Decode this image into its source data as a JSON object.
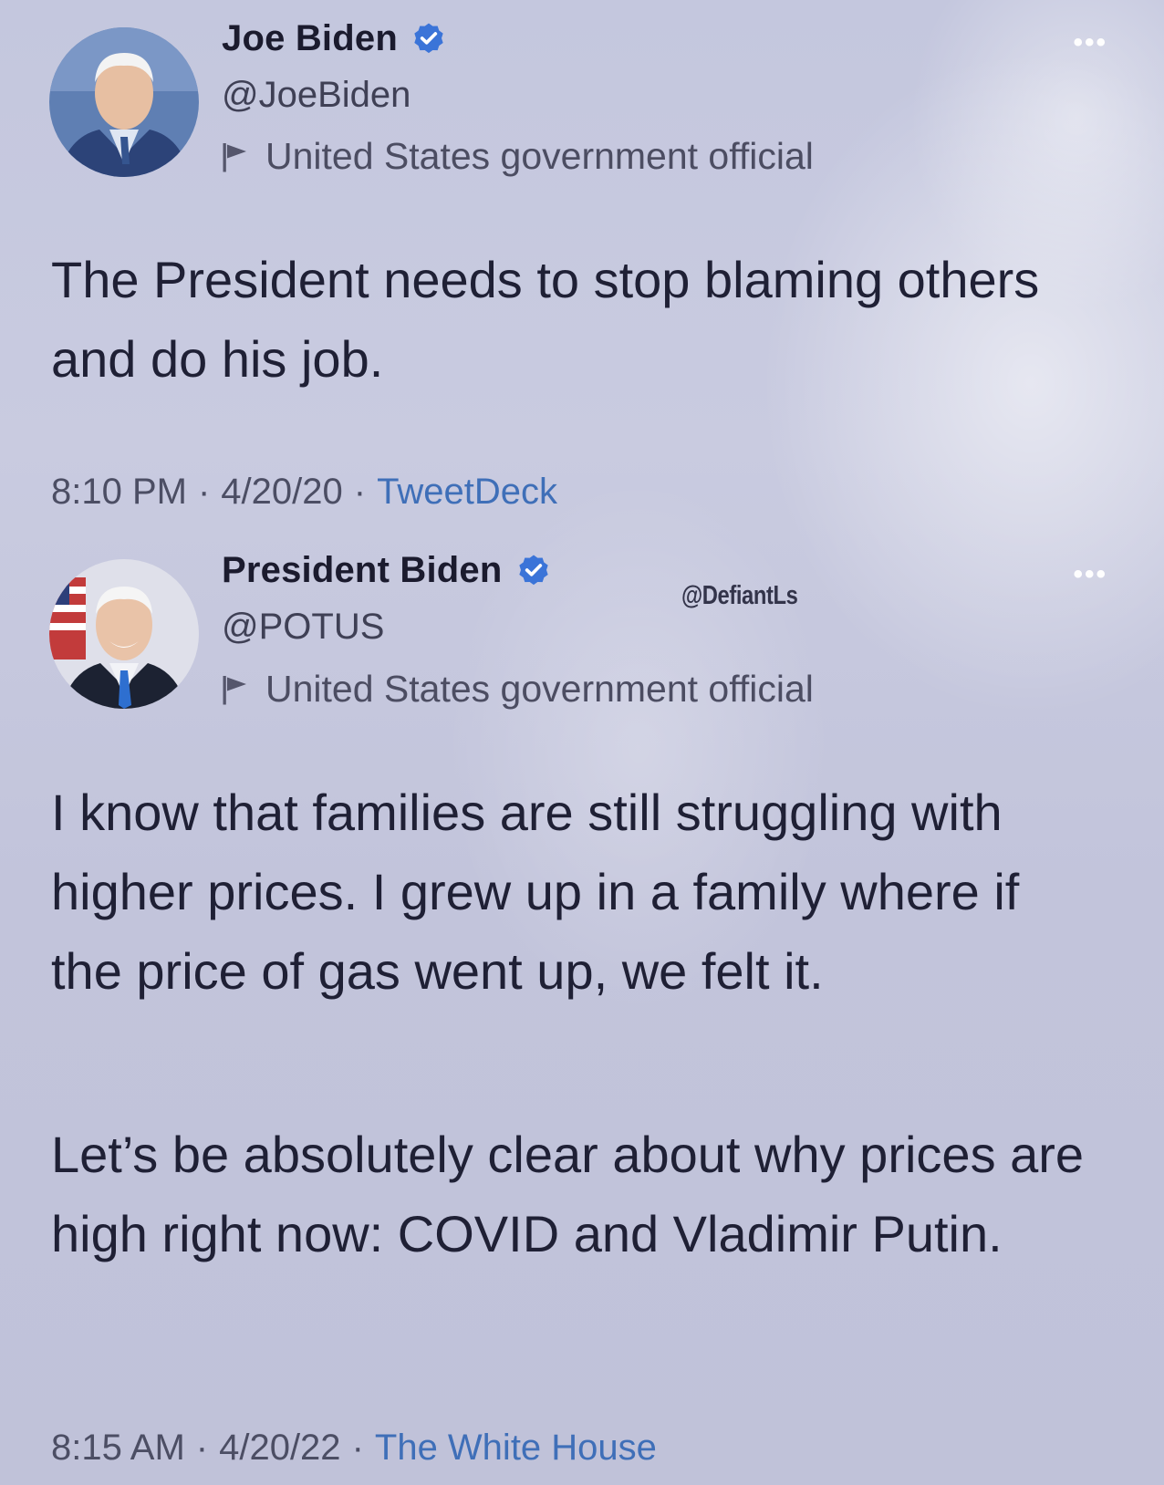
{
  "tweets": [
    {
      "name": "Joe Biden",
      "handle": "@JoeBiden",
      "label": "United States government official",
      "text": "The President needs to stop blaming others and do his job.",
      "time": "8:10 PM",
      "date": "4/20/20",
      "source": "TweetDeck",
      "more_icon": "more-horizontal-icon"
    },
    {
      "name": "President Biden",
      "handle": "@POTUS",
      "label": "United States government official",
      "paragraphs": [
        "I know that families are still struggling with higher prices. I grew up in a family where if the price of gas went up, we felt it.",
        "Let’s be absolutely clear about why prices are high right now: COVID and Vladimir Putin."
      ],
      "time": "8:15 AM",
      "date": "4/20/22",
      "source": "The White House",
      "more_icon": "more-horizontal-icon"
    }
  ],
  "watermark": "@DefiantLs",
  "colors": {
    "verified": "#3b74d8",
    "link": "#3f6fb8",
    "background": "#c6c8de"
  },
  "separator": "·",
  "more_glyph": "•••"
}
